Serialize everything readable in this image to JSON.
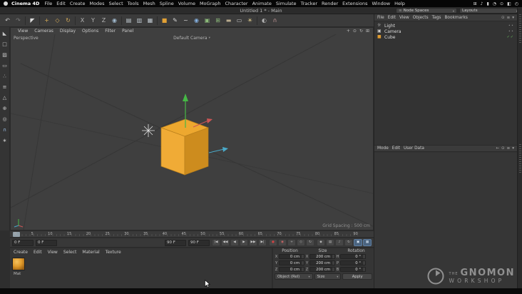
{
  "ui": {
    "caret_down": "▾",
    "menu_glyph": "≡"
  },
  "menubar": {
    "app_name": "Cinema 4D",
    "items": [
      "File",
      "Edit",
      "Create",
      "Modes",
      "Select",
      "Tools",
      "Mesh",
      "Spline",
      "Volume",
      "MoGraph",
      "Character",
      "Animate",
      "Simulate",
      "Tracker",
      "Render",
      "Extensions",
      "Window",
      "Help"
    ],
    "status_icons": [
      {
        "name": "keyboard-status-icon",
        "glyph": "⊞"
      },
      {
        "name": "volume-status-icon",
        "glyph": "♪"
      },
      {
        "name": "battery-status-icon",
        "glyph": "▮"
      },
      {
        "name": "wifi-status-icon",
        "glyph": "◔"
      },
      {
        "name": "spotlight-status-icon",
        "glyph": "⊙"
      },
      {
        "name": "control-center-status-icon",
        "glyph": "◧"
      },
      {
        "name": "clock-status-icon",
        "glyph": "◴"
      }
    ]
  },
  "titlebar": {
    "title": "Untitled 1 * - Main",
    "node_spaces_label": "Node Spaces",
    "layouts_label": "Layouts"
  },
  "toolbar": {
    "g1": [
      {
        "name": "undo-button",
        "glyph": "↶",
        "color": "#c9c9c9"
      },
      {
        "name": "redo-button",
        "glyph": "↷",
        "color": "#7d7d7d"
      }
    ],
    "g2": [
      {
        "name": "live-selection-tool",
        "glyph": "◤",
        "color": "#dedede"
      }
    ],
    "g3": [
      {
        "name": "move-tool",
        "glyph": "+",
        "color": "#d2a957"
      },
      {
        "name": "scale-tool",
        "glyph": "◇",
        "color": "#d2a957"
      },
      {
        "name": "rotate-tool",
        "glyph": "↻",
        "color": "#d2a957"
      }
    ],
    "g4": [
      {
        "name": "x-axis-lock",
        "glyph": "X",
        "color": "#b5b5b5"
      },
      {
        "name": "y-axis-lock",
        "glyph": "Y",
        "color": "#b5b5b5"
      },
      {
        "name": "z-axis-lock",
        "glyph": "Z",
        "color": "#b5b5b5"
      },
      {
        "name": "coordinate-system-toggle",
        "glyph": "◉",
        "color": "#9fb8cc"
      }
    ],
    "g5": [
      {
        "name": "render-view-button",
        "glyph": "▤",
        "color": "#bfc8cf"
      },
      {
        "name": "render-picture-viewer-button",
        "glyph": "▥",
        "color": "#bfc8cf"
      },
      {
        "name": "render-settings-button",
        "glyph": "▦",
        "color": "#bfc8cf"
      }
    ],
    "g6": [
      {
        "name": "add-cube-button",
        "glyph": "■",
        "color": "#e2a135"
      },
      {
        "name": "pen-tool-button",
        "glyph": "✎",
        "color": "#d8d8d8"
      },
      {
        "name": "spline-tool-button",
        "glyph": "~",
        "color": "#d8d8d8"
      },
      {
        "name": "subdivision-surface-button",
        "glyph": "◉",
        "color": "#83aedd"
      },
      {
        "name": "symmetry-button",
        "glyph": "▣",
        "color": "#8cbb7a"
      },
      {
        "name": "cloner-button",
        "glyph": "⊞",
        "color": "#8cbb7a"
      },
      {
        "name": "floor-object-button",
        "glyph": "▬",
        "color": "#b9ab8e"
      },
      {
        "name": "camera-object-button",
        "glyph": "▭",
        "color": "#c2c2c2"
      },
      {
        "name": "light-object-button",
        "glyph": "☀",
        "color": "#e5d190"
      }
    ],
    "g7": [
      {
        "name": "display-filter-button",
        "glyph": "◐",
        "color": "#b2b2b2"
      },
      {
        "name": "snap-toggle-button",
        "glyph": "∩",
        "color": "#c89b9b"
      }
    ]
  },
  "left_tools": [
    {
      "name": "make-editable-button",
      "glyph": "◣",
      "color": "#c6c6c6"
    },
    {
      "name": "model-mode-button",
      "glyph": "□",
      "color": "#c6c6c6"
    },
    {
      "name": "texture-mode-button",
      "glyph": "▨",
      "color": "#c6c6c6"
    },
    {
      "name": "workplane-mode-button",
      "glyph": "▭",
      "color": "#c6c6c6"
    },
    {
      "name": "points-mode-button",
      "glyph": "∴",
      "color": "#c6c6c6"
    },
    {
      "name": "edges-mode-button",
      "glyph": "≡",
      "color": "#c6c6c6"
    },
    {
      "name": "polygons-mode-button",
      "glyph": "△",
      "color": "#c6c6c6"
    },
    {
      "name": "enable-axis-button",
      "glyph": "⊕",
      "color": "#c6c6c6"
    },
    {
      "name": "viewport-solo-button",
      "glyph": "◎",
      "color": "#c6c6c6"
    },
    {
      "name": "snap-settings-button",
      "glyph": "∩",
      "color": "#9fc2e8"
    },
    {
      "name": "modeling-settings-button",
      "glyph": "∗",
      "color": "#c6c6c6"
    }
  ],
  "viewport": {
    "menu": [
      "View",
      "Cameras",
      "Display",
      "Options",
      "Filter",
      "Panel"
    ],
    "corner_icons": [
      {
        "name": "pan-view-icon",
        "glyph": "+"
      },
      {
        "name": "zoom-view-icon",
        "glyph": "⊙"
      },
      {
        "name": "rotate-view-icon",
        "glyph": "↻"
      },
      {
        "name": "toggle-views-icon",
        "glyph": "⊞"
      }
    ],
    "view_label": "Perspective",
    "camera_label": "Default Camera",
    "grid_spacing": "Grid Spacing : 500 cm",
    "colors": {
      "cube_top": "#eda82f",
      "cube_front": "#f0ab36",
      "cube_right": "#cd8c1e",
      "axis_y": "#46b846",
      "axis_x": "#cc5555",
      "axis_z": "#4aa9c8",
      "background": "#3f3f3f"
    }
  },
  "object_manager": {
    "menu": [
      "File",
      "Edit",
      "View",
      "Objects",
      "Tags",
      "Bookmarks"
    ],
    "menu_icons": [
      {
        "name": "search-icon",
        "glyph": "⊙"
      },
      {
        "name": "filter-icon",
        "glyph": "≡"
      },
      {
        "name": "panel-menu-icon",
        "glyph": "▾"
      }
    ],
    "objects": [
      {
        "name": "Light",
        "glyph": "☼",
        "color": "#d8d8d8",
        "tags": "∙∙"
      },
      {
        "name": "Camera",
        "glyph": "▣",
        "color": "#c8c8c8",
        "tags": "∙∙"
      },
      {
        "name": "Cube",
        "glyph": "■",
        "color": "#e09b30",
        "tags": "✓✓"
      }
    ]
  },
  "attribute_manager": {
    "menu": [
      "Mode",
      "Edit",
      "User Data"
    ],
    "menu_icons": [
      {
        "name": "back-arrow-icon",
        "glyph": "←"
      },
      {
        "name": "pin-icon",
        "glyph": "⊙"
      },
      {
        "name": "filter-icon",
        "glyph": "≡"
      },
      {
        "name": "options-icon",
        "glyph": "▾"
      }
    ]
  },
  "timeline": {
    "ticks": [
      "0",
      "5",
      "10",
      "15",
      "20",
      "25",
      "30",
      "35",
      "40",
      "45",
      "50",
      "55",
      "60",
      "65",
      "70",
      "75",
      "80",
      "85",
      "90"
    ],
    "start_frame": "0 F",
    "current_frame": "0 F",
    "preview_end": "90 F",
    "end_frame": "90 F",
    "transport_buttons": [
      {
        "name": "goto-start-button",
        "glyph": "|◀",
        "color": "#cccccc"
      },
      {
        "name": "previous-key-button",
        "glyph": "◀◀",
        "color": "#cccccc"
      },
      {
        "name": "previous-frame-button",
        "glyph": "◀",
        "color": "#cccccc"
      },
      {
        "name": "play-button",
        "glyph": "▶",
        "color": "#cccccc"
      },
      {
        "name": "next-key-button",
        "glyph": "▶▶",
        "color": "#cccccc"
      },
      {
        "name": "goto-end-button",
        "glyph": "▶|",
        "color": "#cccccc"
      }
    ],
    "record_buttons": [
      {
        "name": "record-keyframe-button",
        "glyph": "●",
        "color": "#cc4444"
      },
      {
        "name": "autokeying-button",
        "glyph": "◉",
        "color": "#cc6666"
      },
      {
        "name": "record-position-toggle",
        "glyph": "+",
        "color": "#b8b8b8"
      },
      {
        "name": "record-scale-toggle",
        "glyph": "◇",
        "color": "#b8b8b8"
      },
      {
        "name": "record-rotation-toggle",
        "glyph": "↻",
        "color": "#b8b8b8"
      }
    ],
    "option_buttons": [
      {
        "name": "keyframe-selection-button",
        "glyph": "◆",
        "color": "#b8b8b8"
      },
      {
        "name": "pla-button",
        "glyph": "▤",
        "color": "#b8b8b8"
      },
      {
        "name": "sound-button",
        "glyph": "♪",
        "color": "#b8b8b8"
      },
      {
        "name": "loop-button",
        "glyph": "↻",
        "color": "#b8b8b8"
      },
      {
        "name": "autokey-indicator",
        "glyph": "▣",
        "color": "#d8e6f2"
      },
      {
        "name": "hud-button",
        "glyph": "▦",
        "color": "#d8e6f2"
      }
    ]
  },
  "material_manager": {
    "menu": [
      "Create",
      "Edit",
      "View",
      "Select",
      "Material",
      "Texture"
    ],
    "material_name": "Mat"
  },
  "coordinates": {
    "position_header": "Position",
    "size_header": "Size",
    "rotation_header": "Rotation",
    "rows": [
      {
        "pl": "X",
        "pv": "0 cm",
        "sl": "X",
        "sv": "200 cm",
        "rl": "H",
        "rv": "0 °"
      },
      {
        "pl": "Y",
        "pv": "0 cm",
        "sl": "Y",
        "sv": "200 cm",
        "rl": "P",
        "rv": "0 °"
      },
      {
        "pl": "Z",
        "pv": "0 cm",
        "sl": "Z",
        "sv": "200 cm",
        "rl": "B",
        "rv": "0 °"
      }
    ],
    "mode_dropdown": "Object (Rel)",
    "size_dropdown": "Size",
    "apply_label": "Apply"
  },
  "watermark": {
    "the": "THE",
    "gnomon": "GNOMON",
    "workshop": "WORKSHOP"
  }
}
